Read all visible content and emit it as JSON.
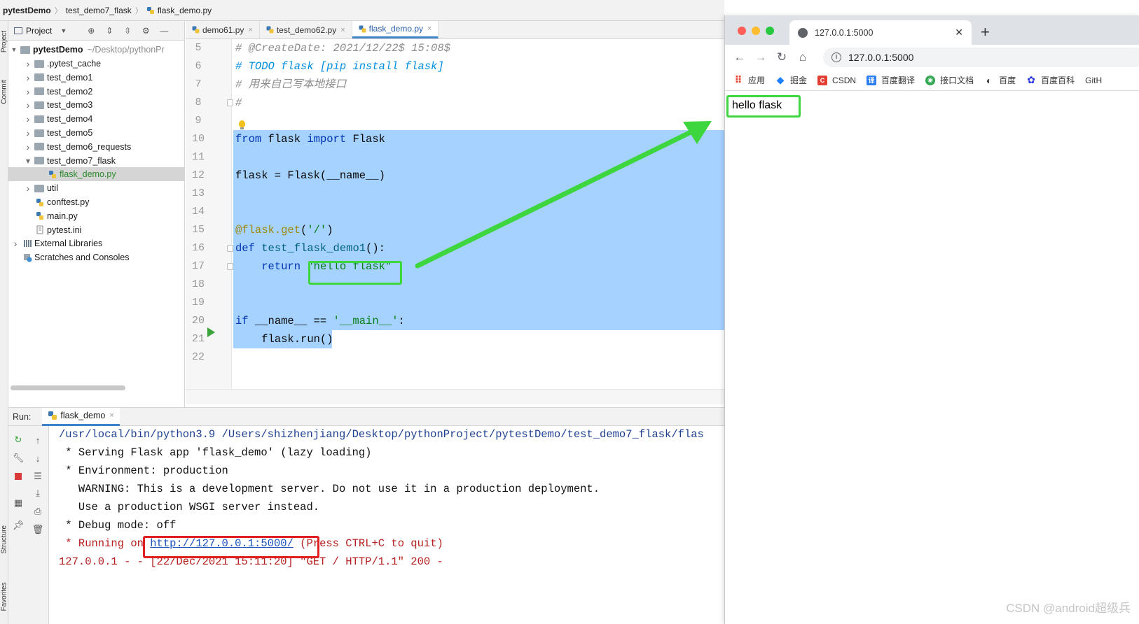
{
  "ide": {
    "breadcrumb": [
      "pytestDemo",
      "test_demo7_flask",
      "flask_demo.py"
    ],
    "stripe": {
      "project": "Project",
      "commit": "Commit",
      "structure": "Structure",
      "favorites": "Favorites"
    },
    "project_panel": {
      "title": "Project",
      "root": {
        "name": "pytestDemo",
        "path": "~/Desktop/pythonPr"
      },
      "items": [
        {
          "label": ".pytest_cache",
          "kind": "folder",
          "level": 1,
          "expand": "collapsed"
        },
        {
          "label": "test_demo1",
          "kind": "folder",
          "level": 1,
          "expand": "collapsed"
        },
        {
          "label": "test_demo2",
          "kind": "folder",
          "level": 1,
          "expand": "collapsed"
        },
        {
          "label": "test_demo3",
          "kind": "folder",
          "level": 1,
          "expand": "collapsed"
        },
        {
          "label": "test_demo4",
          "kind": "folder",
          "level": 1,
          "expand": "collapsed"
        },
        {
          "label": "test_demo5",
          "kind": "folder",
          "level": 1,
          "expand": "collapsed"
        },
        {
          "label": "test_demo6_requests",
          "kind": "folder",
          "level": 1,
          "expand": "collapsed"
        },
        {
          "label": "test_demo7_flask",
          "kind": "folder",
          "level": 1,
          "expand": "expanded"
        },
        {
          "label": "flask_demo.py",
          "kind": "pyfile",
          "level": 2,
          "expand": "none",
          "selected": true
        },
        {
          "label": "util",
          "kind": "folder",
          "level": 1,
          "expand": "collapsed"
        },
        {
          "label": "conftest.py",
          "kind": "pyfile",
          "level": 1,
          "expand": "none"
        },
        {
          "label": "main.py",
          "kind": "pyfile",
          "level": 1,
          "expand": "none"
        },
        {
          "label": "pytest.ini",
          "kind": "inifile",
          "level": 1,
          "expand": "none"
        },
        {
          "label": "External Libraries",
          "kind": "library",
          "level": 0,
          "expand": "collapsed"
        },
        {
          "label": "Scratches and Consoles",
          "kind": "scratch",
          "level": 0,
          "expand": "none"
        }
      ]
    },
    "editor": {
      "tabs": [
        {
          "label": "demo61.py",
          "active": false
        },
        {
          "label": "test_demo62.py",
          "active": false
        },
        {
          "label": "flask_demo.py",
          "active": true
        }
      ],
      "lines": [
        {
          "no": "5",
          "tokens": [
            [
              "cmt",
              "# @CreateDate: 2021/12/22$ 15:08$"
            ]
          ]
        },
        {
          "no": "6",
          "tokens": [
            [
              "todo",
              "# TODO flask [pip install flask]"
            ]
          ]
        },
        {
          "no": "7",
          "tokens": [
            [
              "cmt",
              "# 用来自己写本地接口"
            ]
          ]
        },
        {
          "no": "8",
          "tokens": [
            [
              "cmt",
              "#"
            ]
          ]
        },
        {
          "no": "9",
          "tokens": []
        },
        {
          "no": "10",
          "tokens": [
            [
              "kw",
              "from"
            ],
            [
              "plain",
              " flask "
            ],
            [
              "kw",
              "import"
            ],
            [
              "plain",
              " Flask"
            ]
          ]
        },
        {
          "no": "11",
          "tokens": []
        },
        {
          "no": "12",
          "tokens": [
            [
              "plain",
              "flask = Flask(__name__)"
            ]
          ]
        },
        {
          "no": "13",
          "tokens": []
        },
        {
          "no": "14",
          "tokens": []
        },
        {
          "no": "15",
          "tokens": [
            [
              "dec",
              "@flask.get"
            ],
            [
              "plain",
              "("
            ],
            [
              "str",
              "'/'"
            ],
            [
              "plain",
              ")"
            ]
          ]
        },
        {
          "no": "16",
          "tokens": [
            [
              "kw",
              "def"
            ],
            [
              "plain",
              " "
            ],
            [
              "fn",
              "test_flask_demo1"
            ],
            [
              "plain",
              "():"
            ]
          ]
        },
        {
          "no": "17",
          "tokens": [
            [
              "plain",
              "    "
            ],
            [
              "kw",
              "return"
            ],
            [
              "plain",
              " "
            ],
            [
              "str",
              "\"hello flask\""
            ]
          ]
        },
        {
          "no": "18",
          "tokens": []
        },
        {
          "no": "19",
          "tokens": []
        },
        {
          "no": "20",
          "tokens": [
            [
              "kw",
              "if"
            ],
            [
              "plain",
              " __name__ == "
            ],
            [
              "str",
              "'__main__'"
            ],
            [
              "plain",
              ":"
            ]
          ]
        },
        {
          "no": "21",
          "tokens": [
            [
              "plain",
              "    flask.run()"
            ]
          ]
        },
        {
          "no": "22",
          "tokens": []
        }
      ]
    },
    "run": {
      "label": "Run:",
      "tab": "flask_demo",
      "console": [
        {
          "style": "path",
          "text": "/usr/local/bin/python3.9 /Users/shizhenjiang/Desktop/pythonProject/pytestDemo/test_demo7_flask/flas"
        },
        {
          "style": "out",
          "text": " * Serving Flask app 'flask_demo' (lazy loading)"
        },
        {
          "style": "out",
          "text": " * Environment: production"
        },
        {
          "style": "out",
          "text": "   WARNING: This is a development server. Do not use it in a production deployment."
        },
        {
          "style": "out",
          "text": "   Use a production WSGI server instead."
        },
        {
          "style": "out",
          "text": " * Debug mode: off"
        },
        {
          "style": "err",
          "text": " * Running on ",
          "link": "http://127.0.0.1:5000/",
          "after": " (Press CTRL+C to quit)"
        },
        {
          "style": "err",
          "text": "127.0.0.1 - - [22/Dec/2021 15:11:20] \"GET / HTTP/1.1\" 200 -"
        }
      ]
    }
  },
  "browser": {
    "tab_title": "127.0.0.1:5000",
    "url": "127.0.0.1:5000",
    "bookmarks": [
      {
        "label": "应用",
        "icon": "apps-grid-icon"
      },
      {
        "label": "掘金",
        "icon": "juejin-icon"
      },
      {
        "label": "CSDN",
        "icon": "csdn-icon"
      },
      {
        "label": "百度翻译",
        "icon": "baidu-translate-icon"
      },
      {
        "label": "接口文档",
        "icon": "api-docs-icon"
      },
      {
        "label": "百度",
        "icon": "globe-icon"
      },
      {
        "label": "百度百科",
        "icon": "baidu-baike-icon"
      },
      {
        "label": "GitH",
        "icon": ""
      }
    ],
    "page_text": "hello flask"
  },
  "colors": {
    "selection": "#a6d2ff",
    "annotation_green": "#3ed63e",
    "annotation_red": "#e02020"
  },
  "watermark": "CSDN @android超级兵"
}
